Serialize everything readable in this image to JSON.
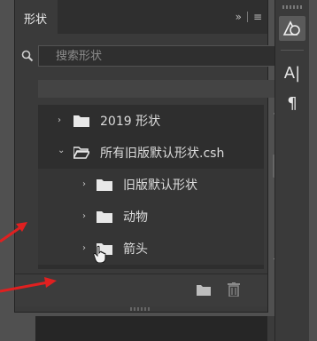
{
  "panel": {
    "tab_label": "形状",
    "header_expand_glyph": "»",
    "header_menu_glyph": "≡"
  },
  "search": {
    "placeholder": "搜索形状"
  },
  "tree": {
    "items": [
      {
        "label": "2019 形状",
        "chevron": "›",
        "depth": 0,
        "expanded": false
      },
      {
        "label": "所有旧版默认形状.csh",
        "chevron": "⌄",
        "depth": 0,
        "expanded": true
      },
      {
        "label": "旧版默认形状",
        "chevron": "›",
        "depth": 1,
        "expanded": false
      },
      {
        "label": "动物",
        "chevron": "›",
        "depth": 1,
        "expanded": false
      },
      {
        "label": "箭头",
        "chevron": "›",
        "depth": 1,
        "expanded": false
      }
    ]
  },
  "scrollbar": {
    "up_glyph": "⌃",
    "down_glyph": "⌄"
  },
  "toolstrip": {
    "tools": [
      {
        "icon": "shapes-icon",
        "glyph": "⬟",
        "active": true
      },
      {
        "icon": "character-icon",
        "glyph": "A|",
        "active": false
      },
      {
        "icon": "paragraph-icon",
        "glyph": "¶",
        "active": false
      }
    ]
  },
  "colors": {
    "panel_bg": "#3a3a3a",
    "tree_bg": "#2e2e2e",
    "annotation_arrow": "#e02020"
  }
}
